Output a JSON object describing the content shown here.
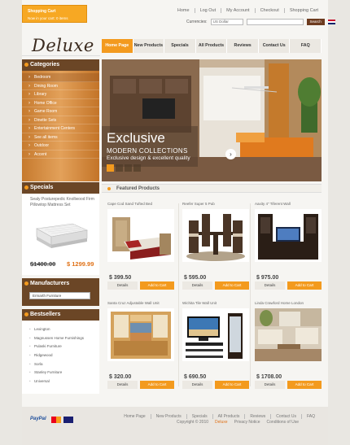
{
  "topbar": {
    "cart_title": "Shopping Cart",
    "cart_status": "Now in your cart: 0 items",
    "links": [
      "Home",
      "Log Out",
      "My Account",
      "Checkout",
      "Shopping Cart"
    ],
    "currencies_label": "Currencies:",
    "currency_value": "US Dollar",
    "search_button": "Search"
  },
  "logo": "Deluxe",
  "mainnav": [
    "Home Page",
    "New Products",
    "Specials",
    "All Products",
    "Reviews",
    "Contact Us",
    "FAQ"
  ],
  "categories": {
    "title": "Categories",
    "items": [
      "Bedroom",
      "Dining Room",
      "Library",
      "Home Office",
      "Game Room",
      "Dinette Sets",
      "Entertainment Centers",
      "See all items",
      "Outdoor",
      "Accent"
    ]
  },
  "specials": {
    "title": "Specials",
    "product_name": "Sealy Posturepedic Knollwood Firm Pillowtop Mattress Set",
    "old_price": "$1400.00",
    "new_price": "$ 1299.99"
  },
  "manufacturers": {
    "title": "Manufacturers",
    "selected": "Ermarth Furniture"
  },
  "bestsellers": {
    "title": "Bestsellers",
    "items": [
      "Lexington",
      "Magnussen Home Furnishings",
      "Pulaski Furniture",
      "Ridgewood",
      "Sorla",
      "Stanley Furniture",
      "Universal"
    ]
  },
  "banner": {
    "headline": "Exclusive",
    "subtitle": "MODERN COLLECTIONS",
    "tagline": "Exclusive design & excellent quality"
  },
  "featured": {
    "title": "Featured Products",
    "details_label": "Details",
    "addcart_label": "Add to Cart",
    "products": [
      {
        "name": "Cape Cod Sand Tufted Bed",
        "price": "$ 399.50"
      },
      {
        "name": "Reefer Super 5 Pub",
        "price": "$ 595.00"
      },
      {
        "name": "Aaxity 4\" Tiferent Wall",
        "price": "$ 975.00"
      },
      {
        "name": "Santa Cruz Adjustable Wall Unit",
        "price": "$ 320.00"
      },
      {
        "name": "Wichita Tile Wall Unit",
        "price": "$ 690.50"
      },
      {
        "name": "Linda Crawford Home London",
        "price": "$ 1708.00"
      }
    ]
  },
  "footer": {
    "payment": "PayPal",
    "links": [
      "Home Page",
      "New Products",
      "Specials",
      "All Products",
      "Reviews",
      "Contact Us",
      "FAQ"
    ],
    "copyright": "Copyright © 2010",
    "brand": "Deluxe",
    "privacy": "Privacy Notice",
    "conditions": "Conditions of Use"
  },
  "colors": {
    "accent": "#f39a1e",
    "brown": "#6b4626",
    "wood": "#d98c3f"
  }
}
